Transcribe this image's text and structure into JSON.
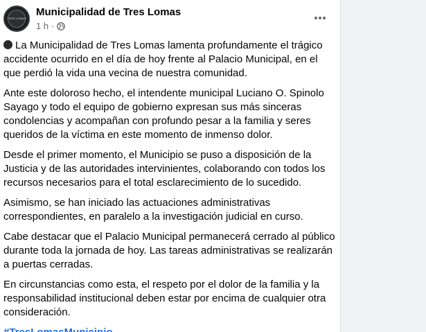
{
  "post": {
    "page_name": "Municipalidad de Tres Lomas",
    "avatar_text": "TRES LOMAS",
    "time": "1 h",
    "separator": "·",
    "privacy_icon": "globe-icon",
    "more_icon": "more-options-icon",
    "bullet_icon": "black-circle-icon",
    "paragraphs": [
      "La Municipalidad de Tres Lomas lamenta profundamente el trágico accidente ocurrido en el día de hoy frente al Palacio Municipal, en el que perdió la vida una vecina de nuestra comunidad.",
      "Ante este doloroso hecho, el intendente municipal Luciano O. Spinolo Sayago y todo el equipo de gobierno expresan sus más sinceras condolencias y acompañan con profundo pesar a la familia y seres queridos de la víctima en este momento de inmenso dolor.",
      "Desde el primer momento, el Municipio se puso a disposición de la Justicia y de las autoridades intervinientes, colaborando con todos los recursos necesarios para el total esclarecimiento de lo sucedido.",
      "Asimismo, se han iniciado las actuaciones administrativas correspondientes, en paralelo a la investigación judicial en curso.",
      "Cabe destacar que el Palacio Municipal permanecerá cerrado al público durante toda la jornada de hoy. Las tareas administrativas se realizarán a puertas cerradas.",
      "En circunstancias como esta, el respeto por el dolor de la familia y la responsabilidad institucional deben estar por encima de cualquier otra consideración."
    ],
    "hashtag": "#TresLomasMunicipio"
  },
  "colors": {
    "text": "#050505",
    "meta": "#65676b",
    "hashtag": "#216fdb",
    "background": "#f0f2f5",
    "card": "#ffffff"
  }
}
